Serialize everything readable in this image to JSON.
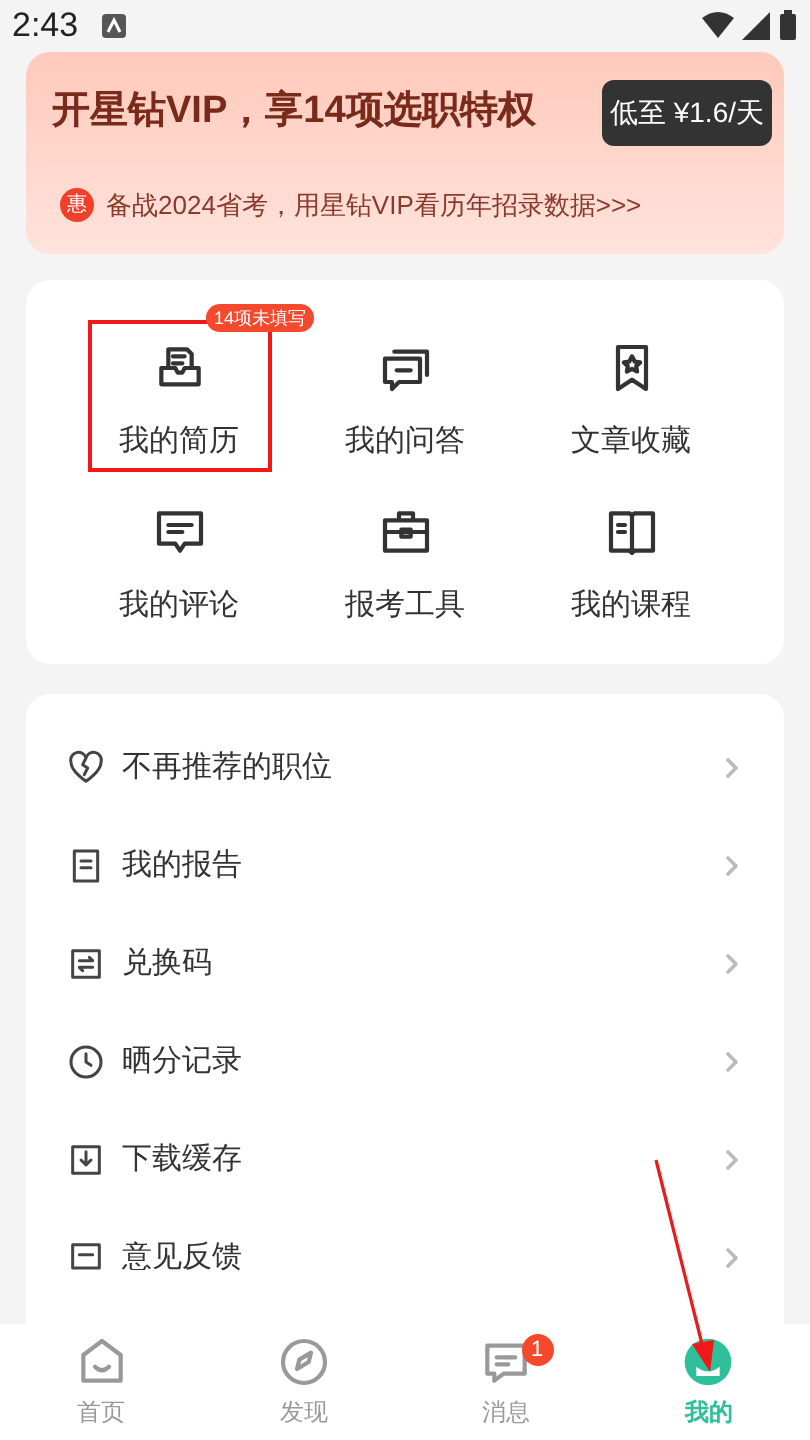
{
  "status_bar": {
    "time": "2:43"
  },
  "vip_banner": {
    "title": "开星钻VIP，享14项选职特权",
    "price_button": "低至 ¥1.6/天",
    "promo_badge": "惠",
    "promo": "备战2024省考，用星钻VIP看历年招录数据>>>"
  },
  "shortcuts": [
    {
      "kind": "resume",
      "label": "我的简历",
      "badge": "14项未填写",
      "highlighted": true
    },
    {
      "kind": "qa",
      "label": "我的问答",
      "highlighted": false
    },
    {
      "kind": "favorite",
      "label": "文章收藏",
      "highlighted": false
    },
    {
      "kind": "comment",
      "label": "我的评论",
      "highlighted": false
    },
    {
      "kind": "tools",
      "label": "报考工具",
      "highlighted": false
    },
    {
      "kind": "course",
      "label": "我的课程",
      "highlighted": false
    }
  ],
  "menu": [
    {
      "kind": "dislike",
      "label": "不再推荐的职位"
    },
    {
      "kind": "report",
      "label": "我的报告"
    },
    {
      "kind": "exchange",
      "label": "兑换码"
    },
    {
      "kind": "history",
      "label": "晒分记录"
    },
    {
      "kind": "download",
      "label": "下载缓存"
    },
    {
      "kind": "feedback",
      "label": "意见反馈"
    }
  ],
  "tab_bar": [
    {
      "kind": "home",
      "label": "首页",
      "selected": false
    },
    {
      "kind": "discover",
      "label": "发现",
      "selected": false
    },
    {
      "kind": "messages",
      "label": "消息",
      "badge": "1",
      "selected": false
    },
    {
      "kind": "me",
      "label": "我的",
      "selected": true
    }
  ]
}
